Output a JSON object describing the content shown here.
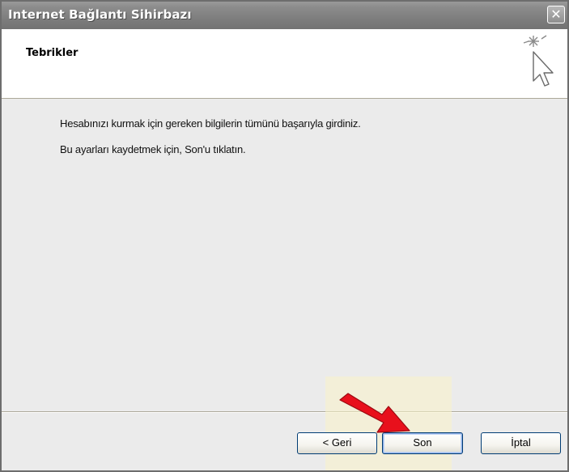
{
  "window": {
    "title": "Internet Bağlantı Sihirbazı",
    "close_label": "✕"
  },
  "header": {
    "title": "Tebrikler"
  },
  "content": {
    "line1": "Hesabınızı kurmak için gereken bilgilerin tümünü başarıyla girdiniz.",
    "line2": "Bu ayarları kaydetmek için, Son'u tıklatın."
  },
  "buttons": {
    "back_label": "< Geri",
    "finish_label": "Son",
    "cancel_label": "İptal"
  },
  "colors": {
    "arrow": "#e8101c",
    "highlight": "#faf2c8",
    "titlebar": "#808080"
  },
  "icons": {
    "wizard": "cursor-sparkle-icon",
    "annotation": "red-arrow-pointer"
  }
}
